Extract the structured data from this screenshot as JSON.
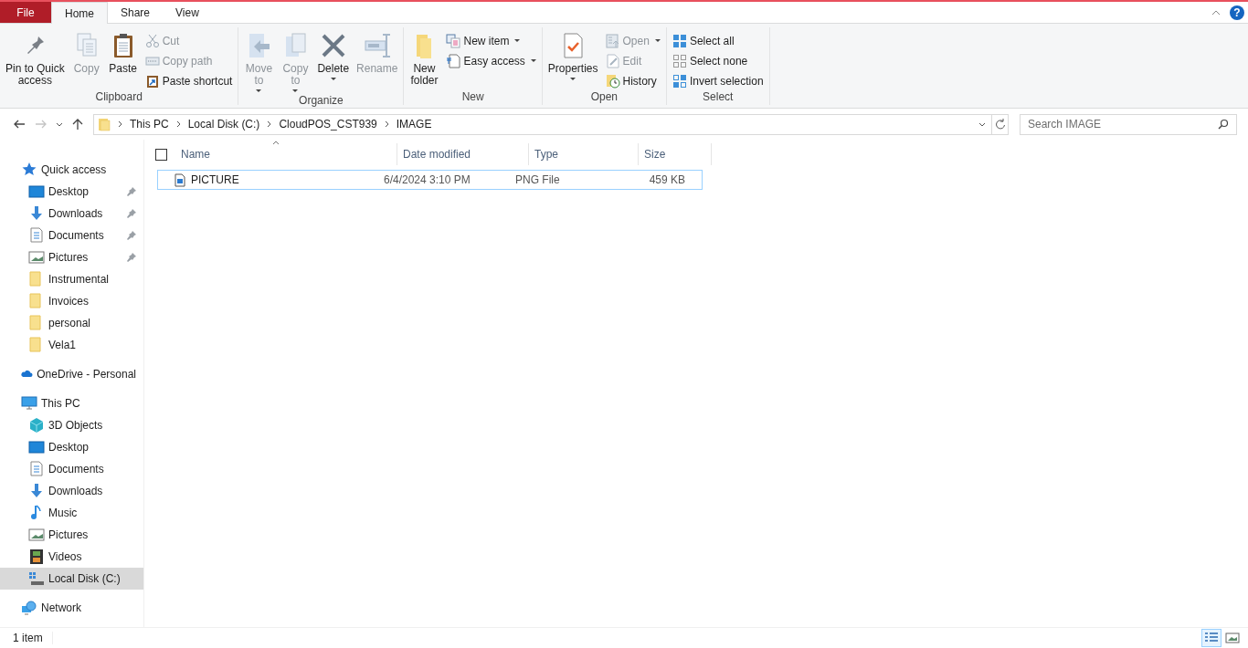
{
  "tabs": [
    {
      "label": "File",
      "kind": "file",
      "selected": false
    },
    {
      "label": "Home",
      "kind": "tab",
      "selected": true
    },
    {
      "label": "Share",
      "kind": "tab",
      "selected": false
    },
    {
      "label": "View",
      "kind": "tab",
      "selected": false
    }
  ],
  "help": {
    "label": "?"
  },
  "ribbon": {
    "groups": [
      {
        "label": "Clipboard",
        "items": [
          {
            "label": "Pin to Quick\naccess",
            "kind": "large",
            "disabled": false,
            "dropdown": false
          },
          {
            "label": "Copy",
            "kind": "large",
            "disabled": true,
            "dropdown": false
          },
          {
            "label": "Paste",
            "kind": "large",
            "disabled": false,
            "dropdown": false
          },
          {
            "label": "Cut",
            "kind": "small",
            "disabled": true,
            "dropdown": false
          },
          {
            "label": "Copy path",
            "kind": "small",
            "disabled": true,
            "dropdown": false
          },
          {
            "label": "Paste shortcut",
            "kind": "small",
            "disabled": false,
            "dropdown": false
          }
        ]
      },
      {
        "label": "Organize",
        "items": [
          {
            "label": "Move\nto",
            "kind": "large",
            "disabled": true,
            "dropdown": true
          },
          {
            "label": "Copy\nto",
            "kind": "large",
            "disabled": true,
            "dropdown": true
          },
          {
            "label": "Delete",
            "kind": "large",
            "disabled": false,
            "dropdown": true
          },
          {
            "label": "Rename",
            "kind": "large",
            "disabled": true,
            "dropdown": false
          }
        ]
      },
      {
        "label": "New",
        "items": [
          {
            "label": "New\nfolder",
            "kind": "large",
            "disabled": false,
            "dropdown": false
          },
          {
            "label": "New item",
            "kind": "small",
            "disabled": false,
            "dropdown": true
          },
          {
            "label": "Easy access",
            "kind": "small",
            "disabled": false,
            "dropdown": true
          }
        ]
      },
      {
        "label": "Open",
        "items": [
          {
            "label": "Properties",
            "kind": "large",
            "disabled": false,
            "dropdown": true
          },
          {
            "label": "Open",
            "kind": "small",
            "disabled": true,
            "dropdown": true
          },
          {
            "label": "Edit",
            "kind": "small",
            "disabled": true,
            "dropdown": false
          },
          {
            "label": "History",
            "kind": "small",
            "disabled": false,
            "dropdown": false
          }
        ]
      },
      {
        "label": "Select",
        "items": [
          {
            "label": "Select all",
            "kind": "small",
            "disabled": false,
            "dropdown": false
          },
          {
            "label": "Select none",
            "kind": "small",
            "disabled": false,
            "dropdown": false
          },
          {
            "label": "Invert selection",
            "kind": "small",
            "disabled": false,
            "dropdown": false
          }
        ]
      }
    ]
  },
  "navigation": [
    {
      "disabled": false
    },
    {
      "disabled": true
    }
  ],
  "address": {
    "crumbs": [
      "This PC",
      "Local Disk (C:)",
      "CloudPOS_CST939",
      "IMAGE"
    ]
  },
  "search": {
    "placeholder": "Search IMAGE"
  },
  "sidebar": {
    "sections": [
      {
        "label": "Quick access",
        "selected": false,
        "children": [
          {
            "label": "Desktop",
            "pinned": true,
            "selected": false
          },
          {
            "label": "Downloads",
            "pinned": true,
            "selected": false
          },
          {
            "label": "Documents",
            "pinned": true,
            "selected": false
          },
          {
            "label": "Pictures",
            "pinned": true,
            "selected": false
          },
          {
            "label": "Instrumental",
            "pinned": false,
            "selected": false
          },
          {
            "label": "Invoices",
            "pinned": false,
            "selected": false
          },
          {
            "label": "personal",
            "pinned": false,
            "selected": false
          },
          {
            "label": "Vela1",
            "pinned": false,
            "selected": false
          }
        ]
      },
      {
        "label": "OneDrive - Personal",
        "selected": false
      },
      {
        "label": "This PC",
        "selected": false,
        "children": [
          {
            "label": "3D Objects",
            "pinned": false,
            "selected": false
          },
          {
            "label": "Desktop",
            "pinned": false,
            "selected": false
          },
          {
            "label": "Documents",
            "pinned": false,
            "selected": false
          },
          {
            "label": "Downloads",
            "pinned": false,
            "selected": false
          },
          {
            "label": "Music",
            "pinned": false,
            "selected": false
          },
          {
            "label": "Pictures",
            "pinned": false,
            "selected": false
          },
          {
            "label": "Videos",
            "pinned": false,
            "selected": false
          },
          {
            "label": "Local Disk (C:)",
            "pinned": false,
            "selected": true
          }
        ]
      },
      {
        "label": "Network",
        "selected": false
      }
    ]
  },
  "table": {
    "header_checkbox": {
      "checked": false
    },
    "columns": [
      "Name",
      "Date modified",
      "Type",
      "Size"
    ],
    "rows": [
      {
        "cells": [
          "PICTURE",
          "6/4/2024 3:10 PM",
          "PNG File",
          "459 KB"
        ],
        "focused": true
      }
    ]
  },
  "status_bar": {
    "text": "1 item"
  },
  "views": [
    {
      "selected": true
    },
    {
      "selected": false
    }
  ]
}
